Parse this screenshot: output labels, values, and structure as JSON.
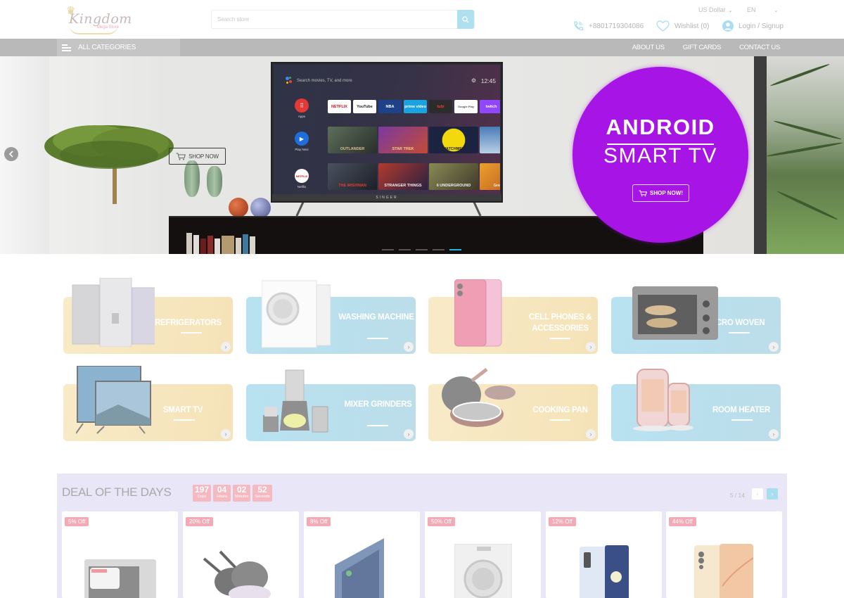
{
  "header": {
    "logo": {
      "name": "Kingdom",
      "tagline": "Mega Store"
    },
    "search": {
      "placeholder": "Search store",
      "icon": "search-icon"
    },
    "currency": {
      "selected": "US Dollar"
    },
    "language": {
      "selected": "EN"
    },
    "phone": {
      "icon": "phone-icon",
      "number": "+8801719304086"
    },
    "wishlist": {
      "icon": "heart-icon",
      "label": "Wishlist (0)"
    },
    "account": {
      "icon": "user-icon",
      "label": "Login / Signup"
    }
  },
  "nav": {
    "all_categories": "ALL CATEGORIES",
    "links": [
      "ABOUT US",
      "GIFT CARDS",
      "CONTACT US"
    ]
  },
  "hero": {
    "shop_now_outline": "SHOP NOW",
    "promo": {
      "line1": "ANDROID",
      "line2": "SMART TV",
      "button": "SHOP NOW!"
    },
    "slides_total": 5,
    "active_slide": 5,
    "tv": {
      "search_hint": "Search movies, TV, and more",
      "clock": "12:45",
      "brand": "SINGER",
      "side_items": [
        "Apps",
        "Play Next",
        "Netflix"
      ],
      "apps": [
        "NETFLIX",
        "YouTube",
        "NBA",
        "prime video",
        "tubi",
        "Google Play",
        "twitch"
      ],
      "row2": [
        "OUTLANDER",
        "STAR TREK",
        "WATCHMEN",
        ""
      ],
      "row3": [
        "THE IRISHMAN",
        "STRANGER THINGS",
        "6 UNDERGROUND",
        "Green Eggs"
      ]
    },
    "colors": {
      "promo": "#a714e6",
      "active_dot": "#1fb6e9"
    }
  },
  "categories": [
    {
      "label": "REFRIGERATORS",
      "theme": "yellow"
    },
    {
      "label": "WASHING MACHINE",
      "theme": "blue"
    },
    {
      "label": "CELL PHONES & ACCESSORIES",
      "theme": "yellow"
    },
    {
      "label": "MICRO WOVEN",
      "theme": "blue"
    },
    {
      "label": "SMART TV",
      "theme": "yellow"
    },
    {
      "label": "MIXER GRINDERS",
      "theme": "blue"
    },
    {
      "label": "COOKING PAN",
      "theme": "yellow"
    },
    {
      "label": "ROOM HEATER",
      "theme": "blue"
    }
  ],
  "deals": {
    "title": "DEAL OF THE DAYS",
    "countdown": [
      {
        "value": "197",
        "unit": "Days"
      },
      {
        "value": "04",
        "unit": "Hours"
      },
      {
        "value": "02",
        "unit": "Minutes"
      },
      {
        "value": "52",
        "unit": "Seconds"
      }
    ],
    "pager": "5 / 14",
    "items": [
      {
        "discount": "5% Off",
        "product": "Konka microwave oven"
      },
      {
        "discount": "20% Off",
        "product": "Cookware pan set"
      },
      {
        "discount": "8% Off",
        "product": "OLED television"
      },
      {
        "discount": "50% Off",
        "product": "Front-load washing machine"
      },
      {
        "discount": "12% Off",
        "product": "Foldable smartphone"
      },
      {
        "discount": "44% Off",
        "product": "Gold smartphone"
      }
    ]
  }
}
